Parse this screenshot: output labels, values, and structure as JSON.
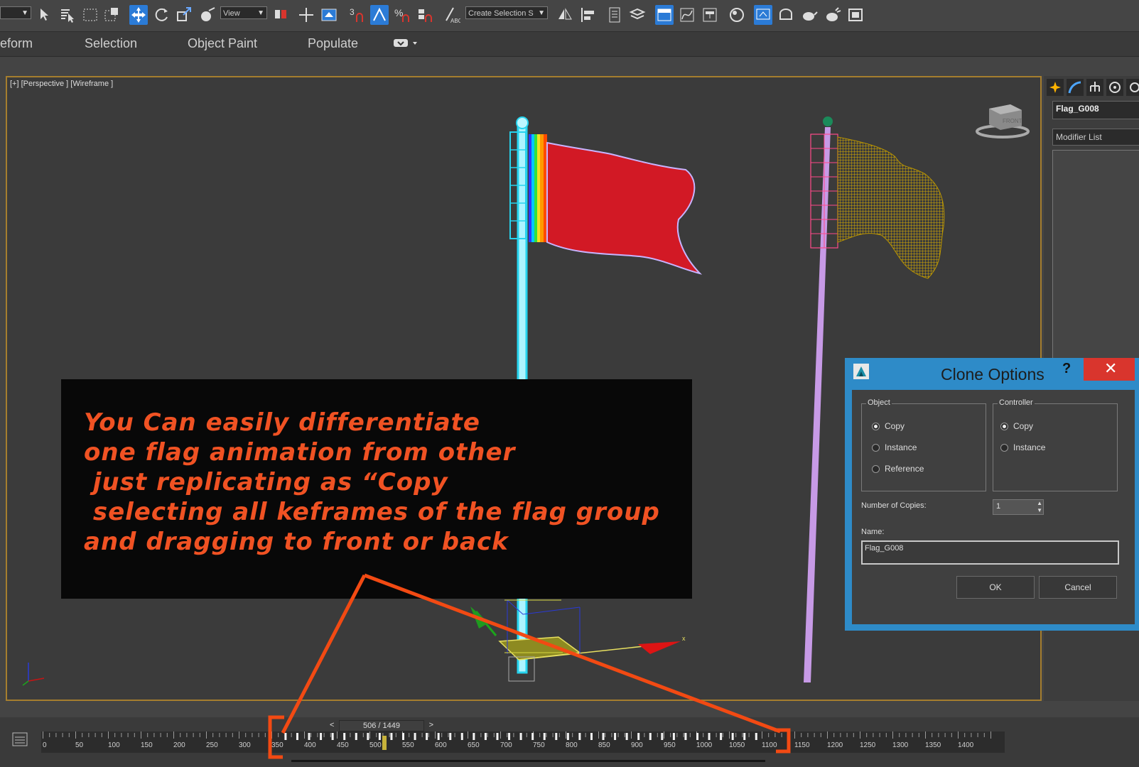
{
  "toolbar": {
    "view_select": "View",
    "selection_set": "Create Selection S",
    "snap_label": "3",
    "percent_snap_label": "%"
  },
  "ribbon": {
    "tabs": [
      "eform",
      "Selection",
      "Object Paint",
      "Populate"
    ]
  },
  "viewport": {
    "label": "[+] [Perspective ] [Wireframe ]",
    "viewcube_label": "FRONT"
  },
  "overlay": {
    "text": "You Can easily differentiate\none flag animation from other\n just replicating as “Copy\n selecting all keframes of the flag group\nand dragging to front or back"
  },
  "command_panel": {
    "object_name": "Flag_G008",
    "modifier_list": "Modifier List"
  },
  "dialog": {
    "title": "Clone Options",
    "help": "?",
    "close": "✕",
    "object_group": "Object",
    "object_options": [
      "Copy",
      "Instance",
      "Reference"
    ],
    "object_selected": "Copy",
    "controller_group": "Controller",
    "controller_options": [
      "Copy",
      "Instance"
    ],
    "controller_selected": "Copy",
    "copies_label": "Number of Copies:",
    "copies_value": "1",
    "name_label": "Name:",
    "name_value": "Flag_G008",
    "ok": "OK",
    "cancel": "Cancel"
  },
  "timeline": {
    "frame_counter": "506 / 1449",
    "prev": "<",
    "next": ">",
    "current_frame": 506,
    "total_frames": 1449,
    "tick_labels": [
      "0",
      "50",
      "100",
      "150",
      "200",
      "250",
      "300",
      "350",
      "400",
      "450",
      "500",
      "550",
      "600",
      "650",
      "700",
      "750",
      "800",
      "850",
      "900",
      "950",
      "1000",
      "1050",
      "1100",
      "1150",
      "1200",
      "1250",
      "1300",
      "1350",
      "1400"
    ]
  },
  "colors": {
    "accent": "#2b7bd6",
    "viewport_border": "#a57e2e",
    "overlay_text": "#f05223",
    "dialog_title_bar": "#2e8bc8",
    "close_button": "#d9352d",
    "red_flag": "#d21925",
    "yellow_flag_mesh": "#c9a200",
    "pole_purple": "#c79ae6"
  }
}
